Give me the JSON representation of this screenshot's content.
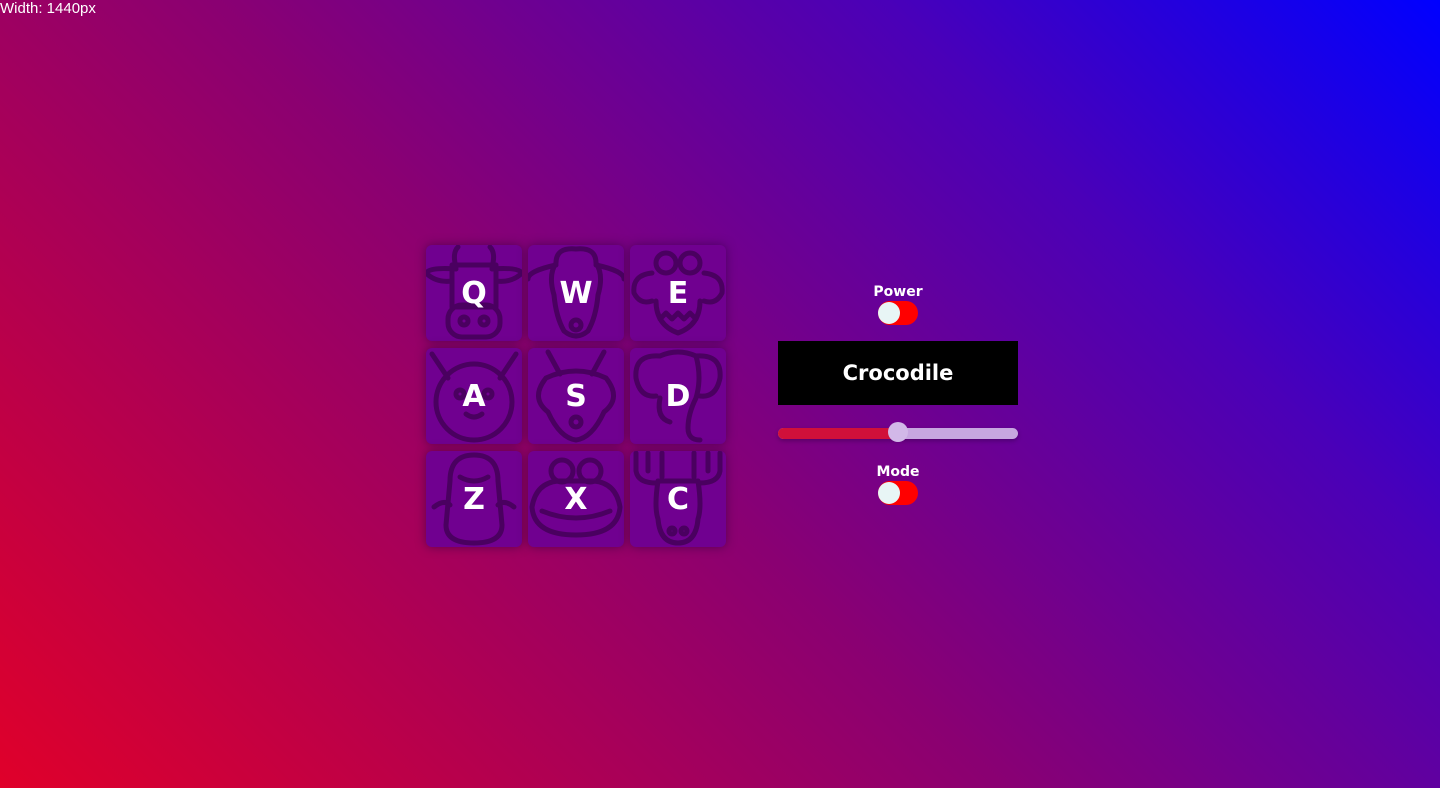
{
  "viewport_label": "Width: 1440px",
  "pads": [
    {
      "key": "Q",
      "icon": "cow-icon"
    },
    {
      "key": "W",
      "icon": "sheep-icon"
    },
    {
      "key": "E",
      "icon": "crocodile-icon"
    },
    {
      "key": "A",
      "icon": "cat-icon"
    },
    {
      "key": "S",
      "icon": "fox-icon"
    },
    {
      "key": "D",
      "icon": "elephant-icon"
    },
    {
      "key": "Z",
      "icon": "seal-icon"
    },
    {
      "key": "X",
      "icon": "frog-icon"
    },
    {
      "key": "C",
      "icon": "moose-icon"
    }
  ],
  "power": {
    "label": "Power",
    "on": true
  },
  "display": {
    "text": "Crocodile"
  },
  "volume": {
    "value": 0.5
  },
  "mode": {
    "label": "Mode",
    "on": true
  },
  "colors": {
    "pad": "#700090",
    "toggle": "#ff0000",
    "slider_fill": "#d0103a",
    "display_bg": "#000000"
  }
}
